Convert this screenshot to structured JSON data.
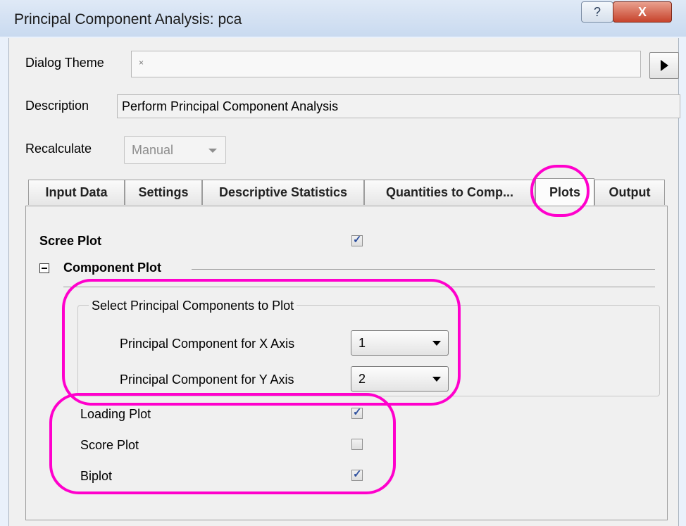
{
  "window": {
    "title": "Principal Component Analysis: pca",
    "help_label": "?",
    "close_label": "X"
  },
  "dialog_theme": {
    "label": "Dialog Theme",
    "value": "×"
  },
  "description": {
    "label": "Description",
    "value": "Perform Principal Component Analysis"
  },
  "recalculate": {
    "label": "Recalculate",
    "value": "Manual"
  },
  "tabs": [
    {
      "label": "Input Data"
    },
    {
      "label": "Settings"
    },
    {
      "label": "Descriptive Statistics"
    },
    {
      "label": "Quantities to Comp..."
    },
    {
      "label": "Plots",
      "active": true
    },
    {
      "label": "Output"
    }
  ],
  "plots": {
    "scree_plot": {
      "label": "Scree Plot",
      "checked": true
    },
    "component_plot": {
      "label": "Component Plot",
      "group_title": "Select Principal Components to Plot",
      "x_axis": {
        "label": "Principal Component for X Axis",
        "value": "1"
      },
      "y_axis": {
        "label": "Principal Component for Y Axis",
        "value": "2"
      }
    },
    "loading_plot": {
      "label": "Loading Plot",
      "checked": true
    },
    "score_plot": {
      "label": "Score Plot",
      "checked": false
    },
    "biplot": {
      "label": "Biplot",
      "checked": true
    }
  },
  "annotation_color": "#ff00cc"
}
